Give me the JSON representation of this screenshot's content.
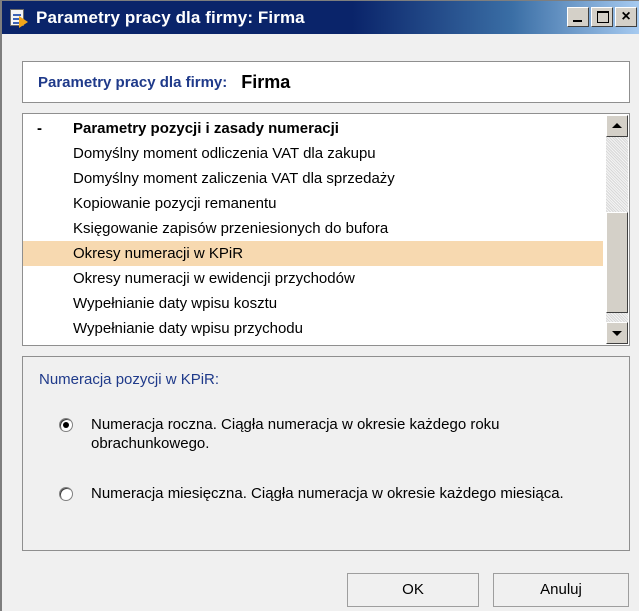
{
  "window": {
    "title": "Parametry pracy dla firmy: Firma",
    "close_glyph": "×"
  },
  "header": {
    "label": "Parametry pracy dla firmy:",
    "value": "Firma"
  },
  "list": {
    "group": {
      "toggle": "-",
      "label": "Parametry pozycji i zasady numeracji"
    },
    "items": [
      {
        "label": "Domyślny moment odliczenia VAT dla zakupu",
        "selected": false
      },
      {
        "label": "Domyślny moment zaliczenia VAT dla sprzedaży",
        "selected": false
      },
      {
        "label": "Kopiowanie pozycji remanentu",
        "selected": false
      },
      {
        "label": "Księgowanie zapisów przeniesionych do bufora",
        "selected": false
      },
      {
        "label": "Okresy numeracji w KPiR",
        "selected": true
      },
      {
        "label": "Okresy numeracji w ewidencji przychodów",
        "selected": false
      },
      {
        "label": "Wypełnianie daty wpisu kosztu",
        "selected": false
      },
      {
        "label": "Wypełnianie daty wpisu przychodu",
        "selected": false
      }
    ],
    "selection_color": "#f7d9b0"
  },
  "options": {
    "title": "Numeracja pozycji w KPiR:",
    "radios": [
      {
        "label": "Numeracja roczna. Ciągła numeracja w okresie każdego roku obrachunkowego.",
        "checked": true
      },
      {
        "label": "Numeracja miesięczna. Ciągła numeracja w okresie każdego miesiąca.",
        "checked": false
      }
    ]
  },
  "buttons": {
    "ok": "OK",
    "cancel": "Anuluj"
  },
  "icons": {
    "title": "document-arrow-icon",
    "minimize": "minimize-icon",
    "maximize": "maximize-icon",
    "close": "close-icon",
    "scroll_up": "arrow-up-icon",
    "scroll_down": "arrow-down-icon"
  }
}
